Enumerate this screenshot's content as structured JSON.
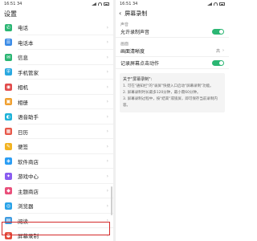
{
  "left": {
    "status": {
      "time": "16:51 34"
    },
    "title": "设置",
    "items": [
      {
        "label": "电话",
        "icon": "phone-icon",
        "color": "#2bb673",
        "glyph": "✆"
      },
      {
        "label": "电话本",
        "icon": "contacts-icon",
        "color": "#3c8ce7",
        "glyph": "☰"
      },
      {
        "label": "信息",
        "icon": "message-icon",
        "color": "#2bb673",
        "glyph": "✉"
      },
      {
        "label": "手机管家",
        "icon": "shield-icon",
        "color": "#29a8e0",
        "glyph": "⛨"
      },
      {
        "label": "相机",
        "icon": "camera-icon",
        "color": "#e24c4c",
        "glyph": "◉"
      },
      {
        "label": "相册",
        "icon": "gallery-icon",
        "color": "#f0a030",
        "glyph": "▣"
      },
      {
        "label": "语音助手",
        "icon": "voice-assistant-icon",
        "color": "#1fb3d9",
        "glyph": "◐"
      },
      {
        "label": "日历",
        "icon": "calendar-icon",
        "color": "#e7584a",
        "glyph": "▦"
      },
      {
        "label": "便签",
        "icon": "notes-icon",
        "color": "#f2b321",
        "glyph": "✎"
      },
      {
        "label": "软件商店",
        "icon": "app-store-icon",
        "color": "#2a9df4",
        "glyph": "◈"
      },
      {
        "label": "游戏中心",
        "icon": "game-center-icon",
        "color": "#8a5cf0",
        "glyph": "✦"
      },
      {
        "label": "主题商店",
        "icon": "theme-store-icon",
        "color": "#e94f7a",
        "glyph": "◆"
      },
      {
        "label": "浏览器",
        "icon": "browser-icon",
        "color": "#2aa3e8",
        "glyph": "◎"
      },
      {
        "label": "阅读",
        "icon": "reader-icon",
        "color": "#3f9be0",
        "glyph": "▤"
      },
      {
        "label": "屏幕录制",
        "icon": "screen-record-icon",
        "color": "#e44b3a",
        "glyph": "●"
      }
    ]
  },
  "right": {
    "status": {
      "time": "16:51 34"
    },
    "title": "屏幕录制",
    "sections": [
      {
        "header": "声音",
        "rows": [
          {
            "label": "允许录制声音",
            "type": "toggle",
            "on": true
          }
        ]
      },
      {
        "header": "画面",
        "rows": [
          {
            "label": "画面清晰度",
            "type": "value",
            "value": "高"
          },
          {
            "label": "记录屏幕点击动作",
            "type": "toggle",
            "on": true
          }
        ]
      }
    ],
    "info": {
      "heading": "关于\"屏幕录制\":",
      "lines": [
        "1. 可在\"通知栏\"的\"录屏\"快捷入口启动\"屏幕录制\"功能。",
        "2. 屏幕录制时长最多120分钟，最小需60分钟。",
        "3. 屏幕录制过程中，按\"结束\"或锁屏，即可保存当前录制内容。"
      ]
    }
  }
}
